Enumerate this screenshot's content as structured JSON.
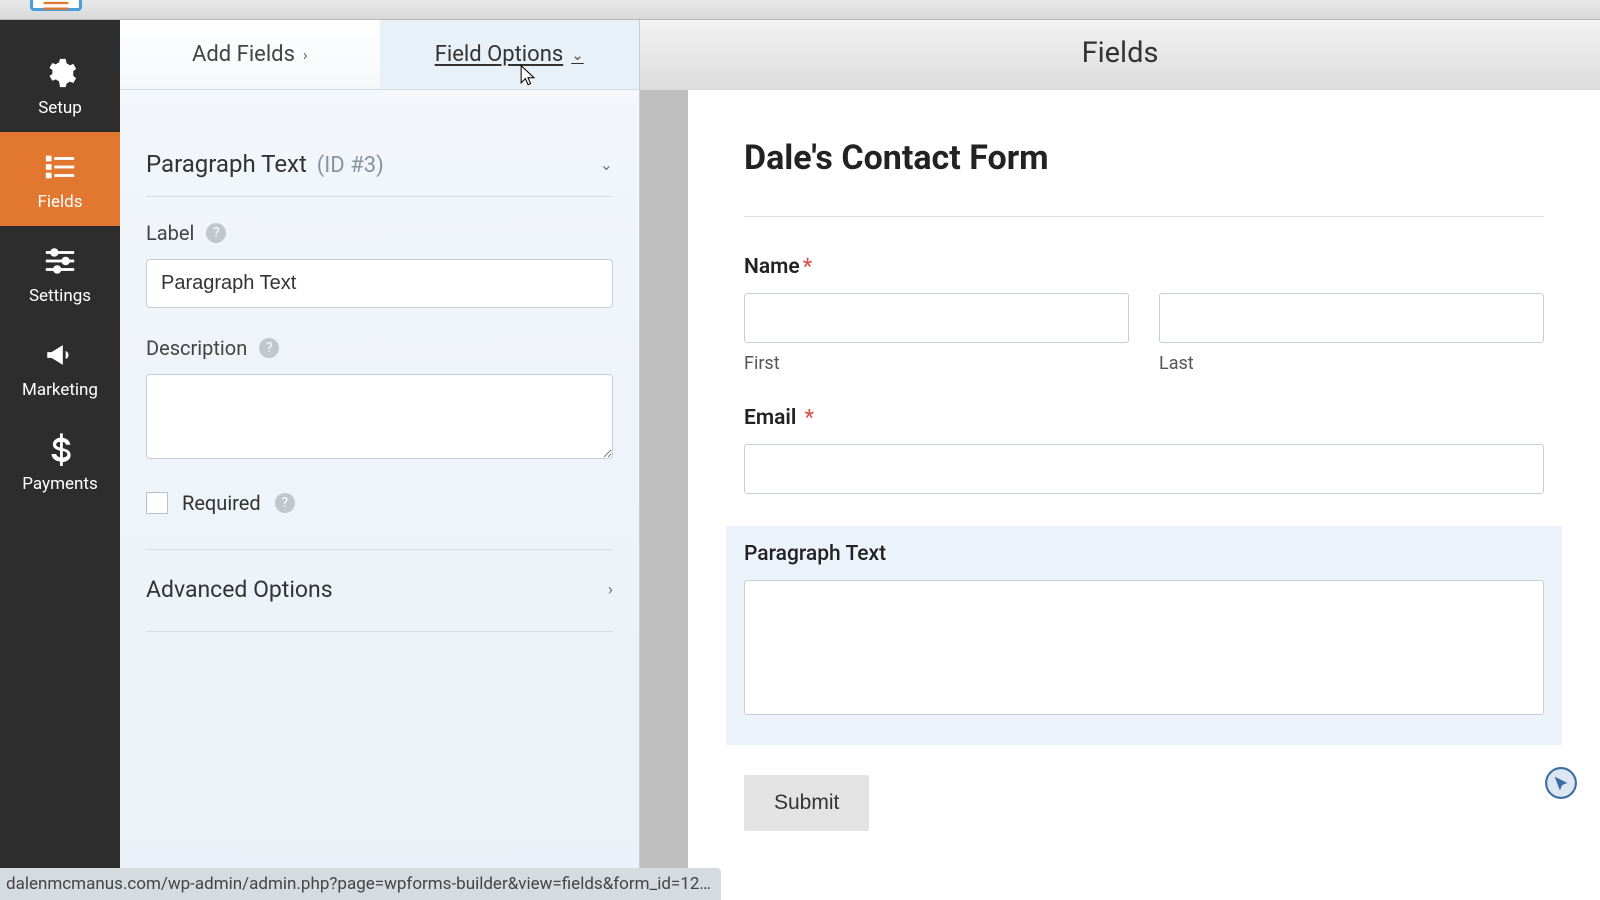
{
  "topbar": {},
  "nav": {
    "items": [
      {
        "label": "Setup",
        "icon": "gear"
      },
      {
        "label": "Fields",
        "icon": "list"
      },
      {
        "label": "Settings",
        "icon": "sliders"
      },
      {
        "label": "Marketing",
        "icon": "megaphone"
      },
      {
        "label": "Payments",
        "icon": "dollar"
      }
    ]
  },
  "tabs": {
    "add": "Add Fields",
    "options": "Field Options"
  },
  "field": {
    "name": "Paragraph Text",
    "id": "(ID #3)",
    "label_lbl": "Label",
    "label_val": "Paragraph Text",
    "desc_lbl": "Description",
    "desc_val": "",
    "required_lbl": "Required",
    "advanced": "Advanced Options"
  },
  "preview": {
    "header": "Fields",
    "title": "Dale's Contact Form",
    "name_label": "Name",
    "first": "First",
    "last": "Last",
    "email_label": "Email",
    "para_label": "Paragraph Text",
    "submit": "Submit"
  },
  "status": "dalenmcmanus.com/wp-admin/admin.php?page=wpforms-builder&view=fields&form_id=12…"
}
